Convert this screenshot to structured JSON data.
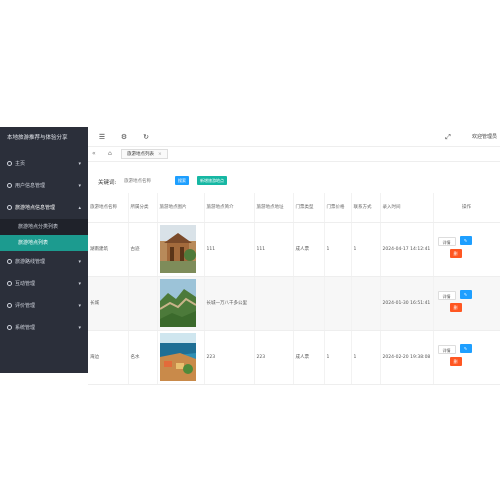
{
  "app": {
    "title": "本地旅游推荐与体验分享"
  },
  "sidebar": {
    "items": [
      {
        "label": "主页",
        "icon": "home-icon"
      },
      {
        "label": "用户信息管理",
        "icon": "user-icon"
      },
      {
        "label": "旅游地点信息管理",
        "icon": "location-icon",
        "children": [
          "旅游地点分类列表",
          "旅游地点列表"
        ]
      },
      {
        "label": "旅游路线管理",
        "icon": "route-icon"
      },
      {
        "label": "互动管理",
        "icon": "chat-icon"
      },
      {
        "label": "评价管理",
        "icon": "star-icon"
      },
      {
        "label": "系统管理",
        "icon": "gear-icon"
      }
    ],
    "active_sub": "旅游地点列表"
  },
  "header": {
    "greeting": "欢迎管理员"
  },
  "tabs": [
    {
      "label": "旅游地点列表"
    }
  ],
  "search": {
    "label": "关键词:",
    "placeholder": "旅游地点名称",
    "search_button": "搜索",
    "add_button": "新增旅游地点"
  },
  "table": {
    "headers": [
      "旅游地点名称",
      "所属分类",
      "旅游地点图片",
      "旅游地点简介",
      "旅游地点地址",
      "门票类型",
      "门票价格",
      "联系方式",
      "录入时间",
      "操作"
    ],
    "rows": [
      {
        "name": "湖南建筑",
        "category": "古迹",
        "image": "temple-photo",
        "intro": "111",
        "address": "111",
        "ticket_type": "成人票",
        "price": "1",
        "contact": "1",
        "time": "2024-04-17 14:12:41"
      },
      {
        "name": "长城",
        "category": "",
        "image": "great-wall-photo",
        "intro": "长城一万八千多公里",
        "address": "",
        "ticket_type": "",
        "price": "",
        "contact": "",
        "time": "2024-01-30 16:51:41"
      },
      {
        "name": "海边",
        "category": "名水",
        "image": "seaside-photo",
        "intro": "223",
        "address": "223",
        "ticket_type": "成人票",
        "price": "1",
        "contact": "1",
        "time": "2024-02-20 19:38:08"
      }
    ],
    "actions": {
      "detail": "详情",
      "edit": "✎",
      "delete": "删"
    }
  },
  "colors": {
    "sidebar_bg": "#2b2f3a",
    "active": "#1c9b8f",
    "primary": "#1e9fff",
    "danger": "#ff5722",
    "teal": "#16b7a3"
  }
}
